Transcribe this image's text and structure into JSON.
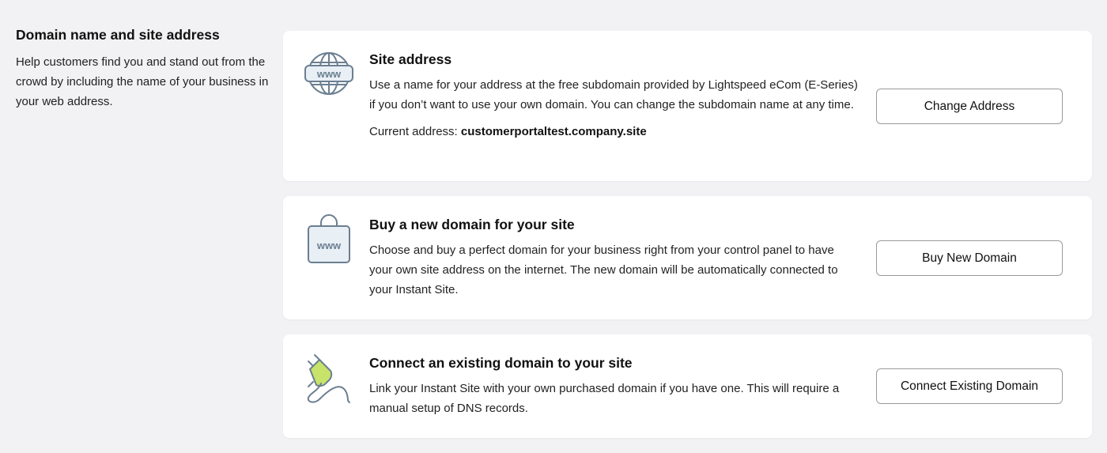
{
  "intro": {
    "title": "Domain name and site address",
    "description": "Help customers find you and stand out from the crowd by including the name of your business in your web address."
  },
  "cards": [
    {
      "title": "Site address",
      "description": "Use a name for your address at the free subdomain provided by Lightspeed eCom (E-Series) if you don’t want to use your own domain. You can change the subdomain name at any time.",
      "current_label": "Current address: ",
      "current_value": "customerportaltest.company.site",
      "button_label": "Change Address",
      "icon": "globe-www-icon"
    },
    {
      "title": "Buy a new domain for your site",
      "description": "Choose and buy a perfect domain for your business right from your control panel to have your own site address on the internet. The new domain will be automatically connected to your Instant Site.",
      "button_label": "Buy New Domain",
      "icon": "shopping-bag-www-icon"
    },
    {
      "title": "Connect an existing domain to your site",
      "description": "Link your Instant Site with your own purchased domain if you have one. This will require a manual setup of DNS records.",
      "button_label": "Connect Existing Domain",
      "icon": "plug-icon"
    }
  ],
  "colors": {
    "background": "#f2f1f3",
    "card": "#ffffff",
    "icon_stroke": "#6b7f90",
    "icon_fill": "#e8eff5",
    "plug_green": "#c7e36a"
  }
}
